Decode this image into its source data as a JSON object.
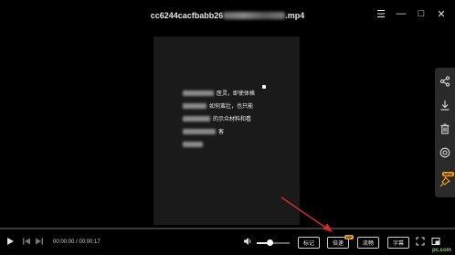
{
  "window": {
    "title_prefix": "cc6244cacfbabb26",
    "title_suffix": ".mp4",
    "buttons": [
      "☰",
      "—",
      "□",
      "✕"
    ]
  },
  "video_text": {
    "line1": "医灵，即使体格",
    "line2": "如何蛮壮，也只能",
    "line3": "的示众材料和看",
    "line4": "客"
  },
  "side_toolbar": {
    "icons": [
      "share-icon",
      "download-icon",
      "delete-icon",
      "target-icon",
      "pin-icon"
    ],
    "pin_badge": "NEW"
  },
  "player": {
    "time": "00:00:00 / 00:00:17",
    "volume_level": 0.4,
    "buttons": {
      "mark": "标记",
      "speed": "倍速",
      "quality": "流畅",
      "subtitle": "字幕"
    },
    "speed_badge": "VIP"
  },
  "watermark": "pc.com",
  "colors": {
    "background": "#000000",
    "accent_badge": "#f2a51d",
    "arrow": "#d42a2a",
    "watermark": "#8ecb49"
  }
}
